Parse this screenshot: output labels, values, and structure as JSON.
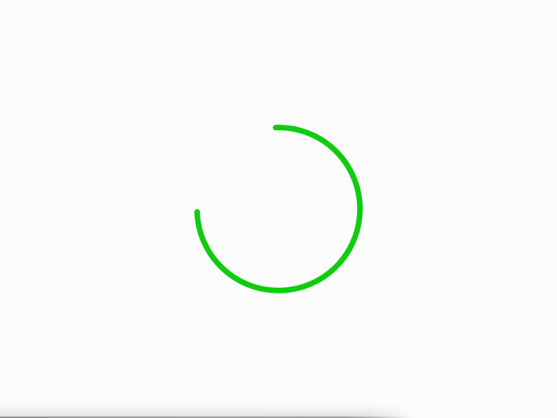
{
  "loading_indicator": {
    "icon": "loading-spinner-icon",
    "color": "#10cc10",
    "progress": 0.75
  },
  "page": {
    "background": "#fdfcfd"
  }
}
